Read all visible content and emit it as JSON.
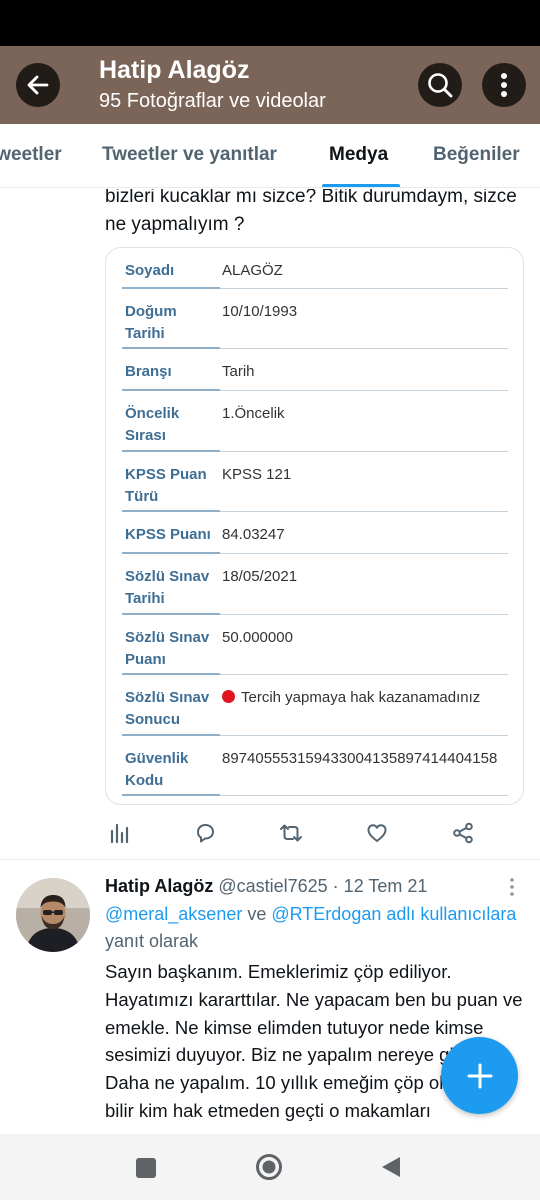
{
  "header": {
    "title": "Hatip Alagöz",
    "subtitle": "95 Fotoğraflar ve videolar"
  },
  "tabs": [
    {
      "label": "Tweetler"
    },
    {
      "label": "Tweetler ve yanıtlar"
    },
    {
      "label": "Medya"
    },
    {
      "label": "Beğeniler"
    }
  ],
  "tweet1": {
    "text": "bizleri kucaklar mı sizce? Bitik durumdaym, sizce ne yapmalıyım ?",
    "rows": [
      {
        "label": "Soyadı",
        "value": "ALAGÖZ"
      },
      {
        "label": "Doğum Tarihi",
        "value": "10/10/1993"
      },
      {
        "label": "Branşı",
        "value": "Tarih"
      },
      {
        "label": "Öncelik Sırası",
        "value": "1.Öncelik"
      },
      {
        "label": "KPSS Puan Türü",
        "value": "KPSS 121"
      },
      {
        "label": "KPSS Puanı",
        "value": "84.03247"
      },
      {
        "label": "Sözlü Sınav Tarihi",
        "value": "18/05/2021"
      },
      {
        "label": "Sözlü Sınav Puanı",
        "value": "50.000000"
      },
      {
        "label": "Sözlü Sınav Sonucu",
        "value": "Tercih yapmaya hak kazanamadınız"
      },
      {
        "label": "Güvenlik Kodu",
        "value": "897405553159433004135897414404158"
      }
    ]
  },
  "tweet2": {
    "name": "Hatip Alagöz",
    "meta": " @castiel7625 · 12 Tem 21",
    "mention1": "@meral_aksener",
    "ve": " ve ",
    "mention2": "@RTErdogan adlı kullanıcılara",
    "reply_suffix": " yanıt olarak",
    "body": "Sayın başkanım. Emeklerimiz çöp ediliyor. Hayatımızı kararttılar. Ne yapacam ben bu puan ve emekle. Ne kimse elimden tutuyor nede kimse sesimizi duyuyor. Biz ne yapalım nereye gidelim. Daha ne yapalım. 10 yıllık emeğim çöp oldu. Kim bilir kim hak etmeden geçti o makamları"
  },
  "colors": {
    "accent": "#1d9bf0",
    "header_bg": "#7b6558",
    "table_label": "#3f6e95",
    "error_dot": "#e0141e"
  },
  "icons": [
    "back-arrow-icon",
    "search-icon",
    "more-vertical-icon",
    "stats-icon",
    "reply-icon",
    "retweet-icon",
    "like-icon",
    "share-icon",
    "compose-plus-icon",
    "nav-square-icon",
    "nav-home-icon",
    "nav-back-icon"
  ]
}
